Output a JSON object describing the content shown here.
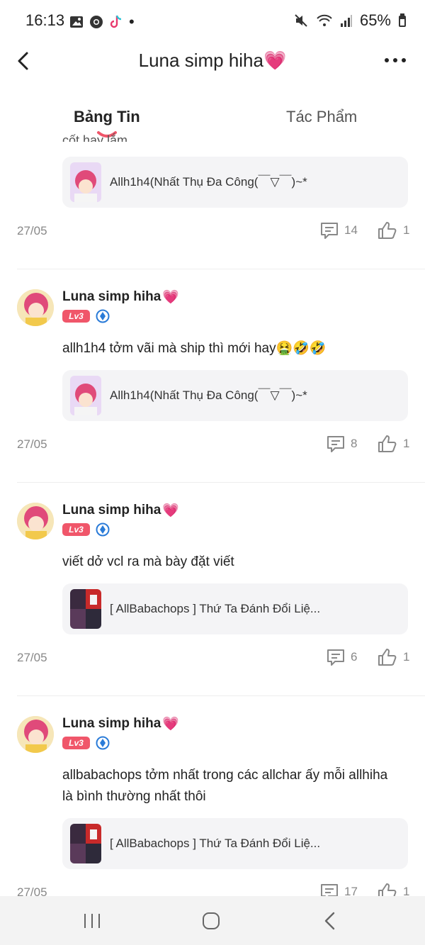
{
  "status_bar": {
    "time": "16:13",
    "battery": "65%",
    "left_icons": [
      "image-icon",
      "chrome-icon",
      "tiktok-icon",
      "notification-dot"
    ],
    "right_icons": [
      "mute-icon",
      "wifi-icon",
      "signal-icon",
      "battery-icon"
    ]
  },
  "header": {
    "title": "Luna simp hiha",
    "title_emoji": "💗",
    "back_icon": "chevron-left-icon",
    "more_icon": "more-dots-icon"
  },
  "tabs": [
    {
      "label": "Bảng Tin",
      "active": true
    },
    {
      "label": "Tác Phẩm",
      "active": false
    }
  ],
  "clipped_text": "cốt hay lắm...",
  "posts": [
    {
      "partial": true,
      "card_title": "Allh1h4(Nhất Thụ Đa Công(￣▽￣)~*",
      "date": "27/05",
      "comments": "14",
      "likes": "1"
    },
    {
      "username": "Luna simp hiha",
      "user_emoji": "💗",
      "level": "Lv3",
      "text": "allh1h4 tởm vãi mà ship thì mới hay🤮🤣🤣",
      "card_title": "Allh1h4(Nhất Thụ Đa Công(￣▽￣)~*",
      "date": "27/05",
      "comments": "8",
      "likes": "1"
    },
    {
      "username": "Luna simp hiha",
      "user_emoji": "💗",
      "level": "Lv3",
      "text": "viết dở vcl ra mà bày đặt viết",
      "card_title": "[ AllBabachops ] Thứ Ta Đánh Đổi Liệ...",
      "date": "27/05",
      "comments": "6",
      "likes": "1"
    },
    {
      "username": "Luna simp hiha",
      "user_emoji": "💗",
      "level": "Lv3",
      "text": "allbabachops tởm nhất trong các allchar ấy mỗi allhiha là bình thường nhất thôi",
      "card_title": "[ AllBabachops ] Thứ Ta Đánh Đổi Liệ...",
      "date": "27/05",
      "comments": "17",
      "likes": "1"
    }
  ],
  "colors": {
    "accent": "#f0566a",
    "verify": "#2a7bd8",
    "card_bg": "#f4f4f6",
    "meta": "#888888"
  },
  "nav_bar": {
    "icons": [
      "recent-apps-icon",
      "home-icon",
      "back-nav-icon"
    ]
  }
}
